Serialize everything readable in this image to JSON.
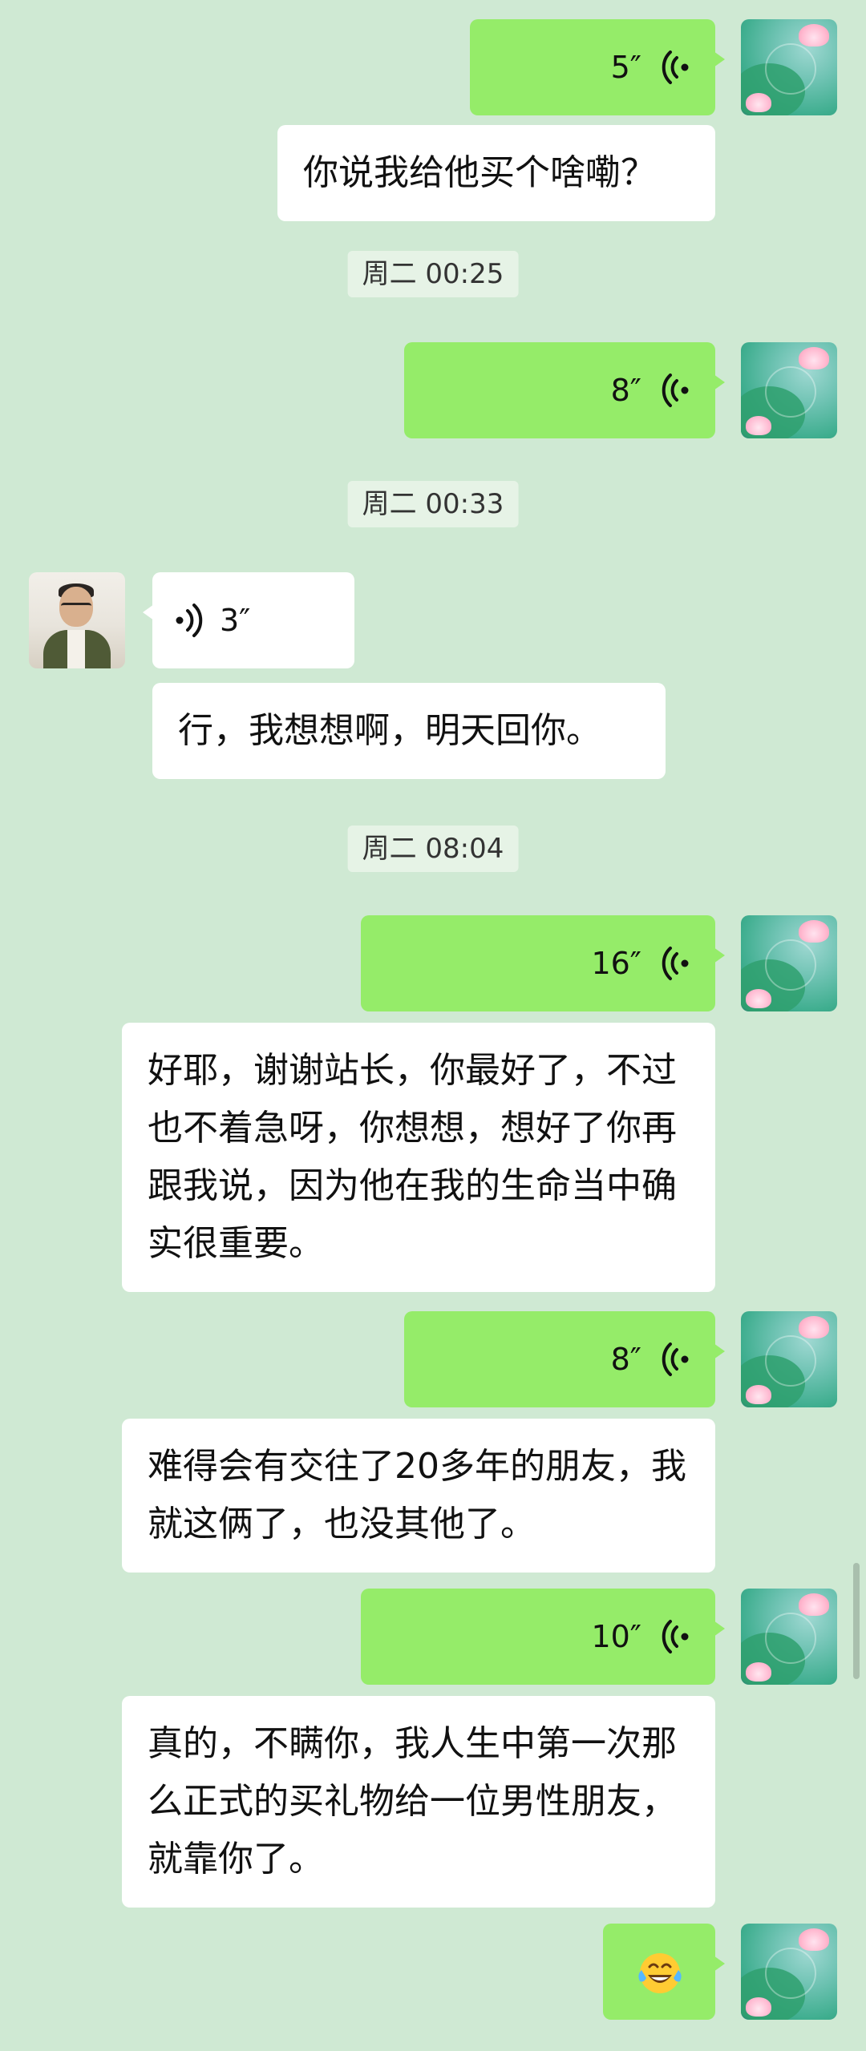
{
  "messages": {
    "m1": {
      "duration": "5″"
    },
    "m2": {
      "text": "你说我给他买个啥嘞？"
    },
    "t1": {
      "label": "周二 00:25"
    },
    "m3": {
      "duration": "8″"
    },
    "t2": {
      "label": "周二 00:33"
    },
    "m4": {
      "duration": "3″"
    },
    "m5": {
      "text": "行，我想想啊，明天回你。"
    },
    "t3": {
      "label": "周二 08:04"
    },
    "m6": {
      "duration": "16″"
    },
    "m7": {
      "text": "好耶，谢谢站长，你最好了，不过也不着急呀，你想想，想好了你再跟我说，因为他在我的生命当中确实很重要。"
    },
    "m8": {
      "duration": "8″"
    },
    "m9": {
      "text": "难得会有交往了20多年的朋友，我就这俩了，也没其他了。"
    },
    "m10": {
      "duration": "10″"
    },
    "m11": {
      "text": "真的，不瞒你，我人生中第一次那么正式的买礼物给一位男性朋友，就靠你了。"
    },
    "m12": {
      "emoji": "laughing-with-tears-face"
    }
  },
  "colors": {
    "background": "#cfe9d3",
    "self_bubble": "#95ec69",
    "other_bubble": "#ffffff",
    "timestamp_chip": "#e6f3e6"
  }
}
